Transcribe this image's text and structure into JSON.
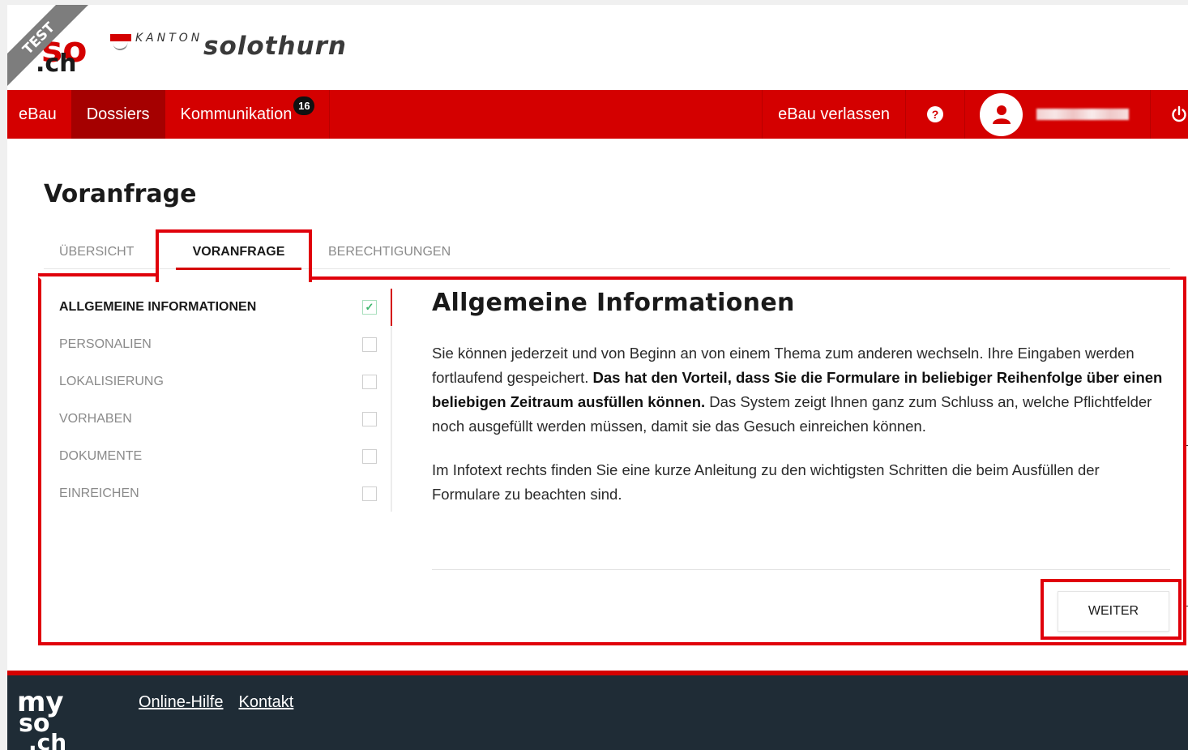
{
  "header": {
    "mysoch_logo_text": ".ch",
    "test_ribbon": "TEST",
    "kanton_word": "KANTON",
    "solothurn_word": "solothurn"
  },
  "nav": {
    "items": [
      {
        "label": "eBau"
      },
      {
        "label": "Dossiers"
      },
      {
        "label": "Kommunikation",
        "badge": "16"
      }
    ],
    "exit_label": "eBau verlassen",
    "help_icon_text": "?",
    "icons": [
      "help-icon",
      "user-icon",
      "power-icon"
    ]
  },
  "page": {
    "title": "Voranfrage"
  },
  "tabs": [
    {
      "label": "ÜBERSICHT"
    },
    {
      "label": "VORANFRAGE"
    },
    {
      "label": "BERECHTIGUNGEN"
    }
  ],
  "sidebar": {
    "items": [
      {
        "label": "ALLGEMEINE INFORMATIONEN",
        "checked": true
      },
      {
        "label": "PERSONALIEN",
        "checked": false
      },
      {
        "label": "LOKALISIERUNG",
        "checked": false
      },
      {
        "label": "VORHABEN",
        "checked": false
      },
      {
        "label": "DOKUMENTE",
        "checked": false
      },
      {
        "label": "EINREICHEN",
        "checked": false
      }
    ]
  },
  "main": {
    "heading": "Allgemeine Informationen",
    "p1_a": "Sie können jederzeit und von Beginn an von einem Thema zum anderen wechseln. Ihre Eingaben werden fortlaufend gespeichert. ",
    "p1_b": "Das hat den Vorteil, dass Sie die Formulare in beliebiger Reihenfolge über einen beliebigen Zeitraum ausfüllen können.",
    "p1_c": " Das System zeigt Ihnen ganz zum Schluss an, welche Pflichtfelder noch ausgefüllt werden müssen, damit sie das Gesuch einreichen können.",
    "p2": "Im Infotext rechts finden Sie eine kurze Anleitung zu den wichtigsten Schritten die beim Ausfüllen der Formulare zu beachten sind.",
    "next_button": "WEITER"
  },
  "footer": {
    "logo_text": "my so .ch",
    "links": [
      {
        "label": "Online-Hilfe"
      },
      {
        "label": "Kontakt"
      }
    ]
  },
  "colors": {
    "brand_red": "#d40000",
    "nav_active": "#a50000",
    "highlight_red": "#e0000b",
    "footer_bg": "#1f2c36",
    "check_green": "#3bb56b"
  }
}
